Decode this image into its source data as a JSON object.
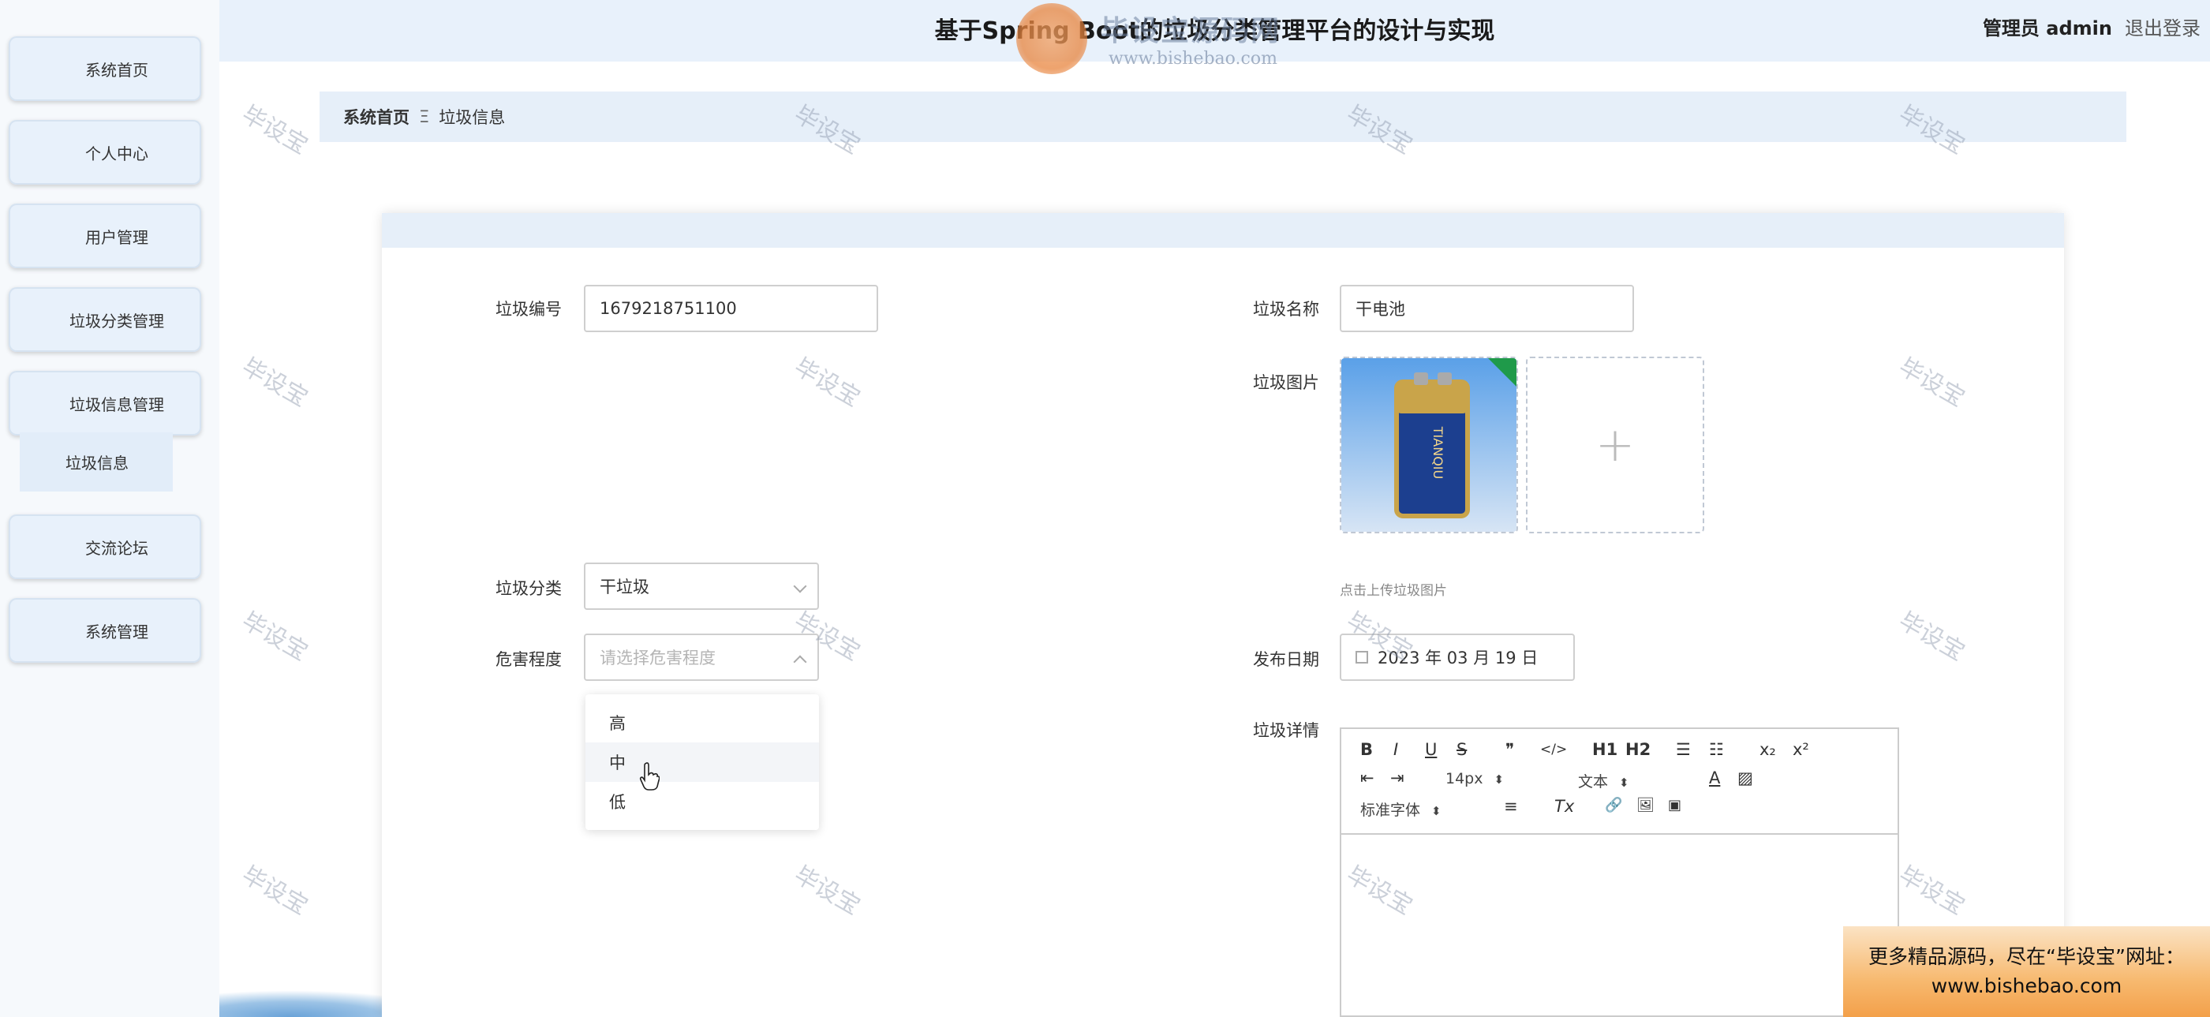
{
  "header": {
    "title": "基于Spring Boot的垃圾分类管理平台的设计与实现",
    "user_label": "管理员 admin",
    "logout": "退出登录"
  },
  "watermark": {
    "logo_text": "毕设宝源码网",
    "logo_url": "www.bishebao.com",
    "tile_text": "毕设宝"
  },
  "sidebar": {
    "items": [
      {
        "label": "系统首页"
      },
      {
        "label": "个人中心"
      },
      {
        "label": "用户管理"
      },
      {
        "label": "垃圾分类管理"
      },
      {
        "label": "垃圾信息管理"
      },
      {
        "label": "交流论坛"
      },
      {
        "label": "系统管理"
      }
    ],
    "submenu": {
      "label": "垃圾信息"
    }
  },
  "breadcrumb": {
    "home": "系统首页",
    "separator": "Ξ",
    "current": "垃圾信息"
  },
  "form": {
    "code": {
      "label": "垃圾编号",
      "value": "1679218751100"
    },
    "name": {
      "label": "垃圾名称",
      "value": "干电池"
    },
    "image": {
      "label": "垃圾图片",
      "upload_plus": "+",
      "hint": "点击上传垃圾图片"
    },
    "category": {
      "label": "垃圾分类",
      "value": "干垃圾"
    },
    "hazard": {
      "label": "危害程度",
      "placeholder": "请选择危害程度"
    },
    "publish_date": {
      "label": "发布日期",
      "value": "2023 年 03 月 19 日"
    },
    "details": {
      "label": "垃圾详情"
    }
  },
  "dropdown": {
    "options": [
      {
        "label": "高"
      },
      {
        "label": "中"
      },
      {
        "label": "低"
      }
    ],
    "hovered_index": 1
  },
  "editor": {
    "toolbar": {
      "bold": "B",
      "italic": "I",
      "underline": "U",
      "strike": "S",
      "quote": "❞",
      "code": "</>",
      "h1": "H1",
      "h2": "H2",
      "ordered_list": "☰",
      "bullet_list": "☷",
      "subscript": "x₂",
      "superscript": "x²",
      "outdent": "⇤",
      "indent": "⇥",
      "font_size": "14px",
      "text_type": "文本",
      "font_color": "A",
      "background_color": "▨",
      "font_family": "标准字体",
      "align": "≡",
      "clear_format": "Tx",
      "link": "🔗",
      "image": "🖼",
      "video": "▣"
    }
  },
  "promo": {
    "line1": "更多精品源码，尽在“毕设宝”网址：",
    "line2": "www.bishebao.com"
  },
  "colors": {
    "header_bg": "#e8f1fb",
    "sidebar_item_bg": "#e8f1fb",
    "promo_orange": "#f3a04a"
  }
}
